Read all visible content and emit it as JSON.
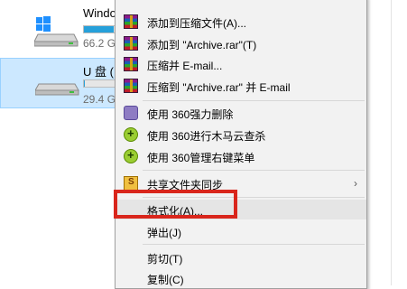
{
  "explorer": {
    "drives": [
      {
        "name": "Windo",
        "size": "66.2 G",
        "used_fraction": 0.72,
        "color": "#26a0da"
      },
      {
        "name": "U 盘 (F",
        "size": "29.4 G",
        "used_fraction": 0.02,
        "color": "#26a0da"
      }
    ]
  },
  "menu": {
    "items": [
      {
        "label": "添加到压缩文件(A)...",
        "icon": "winrar-icon"
      },
      {
        "label": "添加到 \"Archive.rar\"(T)",
        "icon": "winrar-icon"
      },
      {
        "label": "压缩并 E-mail...",
        "icon": "winrar-icon"
      },
      {
        "label": "压缩到 \"Archive.rar\" 并 E-mail",
        "icon": "winrar-icon"
      },
      {
        "label": "使用 360强力删除",
        "icon": "360-shred-icon"
      },
      {
        "label": "使用 360进行木马云查杀",
        "icon": "360-scan-icon"
      },
      {
        "label": "使用 360管理右键菜单",
        "icon": "360-menu-icon"
      },
      {
        "label": "共享文件夹同步",
        "icon": "share-sync-icon",
        "submenu_arrow": "›"
      },
      {
        "label": "格式化(A)..."
      },
      {
        "label": "弹出(J)"
      },
      {
        "label": "剪切(T)"
      },
      {
        "label": "复制(C)"
      }
    ]
  },
  "annotation": {
    "color": "#d9261c",
    "target": "格式化(A)..."
  }
}
